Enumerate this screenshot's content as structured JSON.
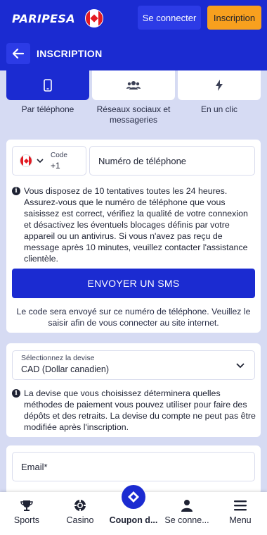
{
  "header": {
    "logo": "PARIPESA",
    "login_label": "Se connecter",
    "register_label": "Inscription"
  },
  "subheader": {
    "title": "INSCRIPTION"
  },
  "methods": [
    {
      "label": "Par téléphone",
      "icon": "smartphone-icon",
      "active": true
    },
    {
      "label": "Réseaux sociaux et messageries",
      "icon": "users-icon",
      "active": false
    },
    {
      "label": "En un clic",
      "icon": "lightning-icon",
      "active": false
    }
  ],
  "phone_form": {
    "code_label": "Code",
    "code_value": "+1",
    "phone_placeholder": "Numéro de téléphone",
    "info_text": "Vous disposez de 10 tentatives toutes les 24 heures. Assurez-vous que le numéro de téléphone que vous saisissez est correct, vérifiez la qualité de votre connexion et désactivez les éventuels blocages définis par votre appareil ou un antivirus. Si vous n'avez pas reçu de message après 10 minutes, veuillez contacter l'assistance clientèle.",
    "sms_button": "ENVOYER UN SMS",
    "sms_note": "Le code sera envoyé sur ce numéro de téléphone. Veuillez le saisir afin de vous connecter au site internet."
  },
  "currency": {
    "label": "Sélectionnez la devise",
    "value": "CAD  (Dollar canadien)",
    "info_text": "La devise que vous choisissez déterminera quelles méthodes de paiement vous pouvez utiliser pour faire des dépôts et des retraits. La devise du compte ne peut pas être modifiée après l'inscription."
  },
  "email": {
    "placeholder": "Email*"
  },
  "bottom_nav": [
    {
      "label": "Sports",
      "icon": "trophy-icon"
    },
    {
      "label": "Casino",
      "icon": "casino-chip-icon"
    },
    {
      "label": "Coupon d...",
      "icon": "ticket-icon"
    },
    {
      "label": "Se conne...",
      "icon": "user-icon"
    },
    {
      "label": "Menu",
      "icon": "hamburger-icon"
    }
  ],
  "colors": {
    "brand_blue": "#1b2bd1",
    "accent_orange": "#f8a01e",
    "page_bg": "#d6dbf3"
  }
}
